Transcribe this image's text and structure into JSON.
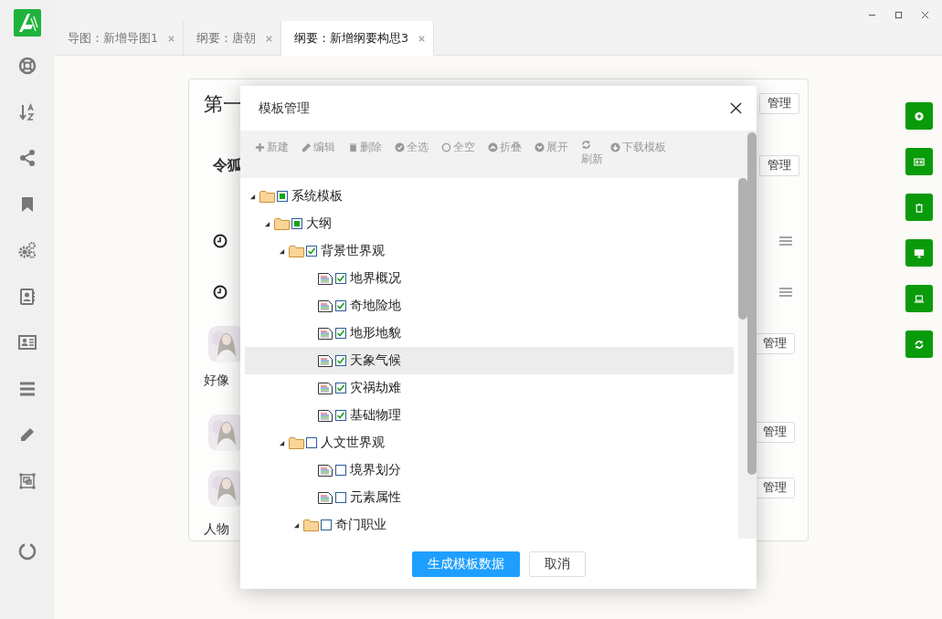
{
  "tabs": [
    {
      "label": "导图：新增导图1",
      "selected": false
    },
    {
      "label": "纲要：唐朝",
      "selected": false
    },
    {
      "label": "纲要：新增纲要构思3",
      "selected": true
    }
  ],
  "card": {
    "title": "第一",
    "subtitle": "令狐",
    "captions": [
      "好像",
      "人物"
    ],
    "manage_buttons": [
      "管理",
      "管理",
      "管理",
      "管理",
      "管理"
    ]
  },
  "dialog": {
    "title": "模板管理",
    "toolbar": [
      "新建",
      "编辑",
      "删除",
      "全选",
      "全空",
      "折叠",
      "展开",
      "刷新",
      "下载模板"
    ],
    "tree": [
      {
        "label": "系统模板",
        "kind": "folder",
        "expanded": true,
        "checked": false,
        "partial": true,
        "selected": false,
        "children": [
          {
            "label": "大纲",
            "kind": "folder",
            "expanded": true,
            "checked": false,
            "partial": true,
            "selected": false,
            "children": [
              {
                "label": "背景世界观",
                "kind": "folder",
                "expanded": true,
                "checked": true,
                "partial": false,
                "selected": false,
                "children": [
                  {
                    "label": "地界概况",
                    "kind": "file",
                    "checked": true,
                    "partial": false,
                    "selected": false
                  },
                  {
                    "label": "奇地险地",
                    "kind": "file",
                    "checked": true,
                    "partial": false,
                    "selected": false
                  },
                  {
                    "label": "地形地貌",
                    "kind": "file",
                    "checked": true,
                    "partial": false,
                    "selected": false
                  },
                  {
                    "label": "天象气候",
                    "kind": "file",
                    "checked": true,
                    "partial": false,
                    "selected": true
                  },
                  {
                    "label": "灾祸劫难",
                    "kind": "file",
                    "checked": true,
                    "partial": false,
                    "selected": false
                  },
                  {
                    "label": "基础物理",
                    "kind": "file",
                    "checked": true,
                    "partial": false,
                    "selected": false
                  }
                ]
              },
              {
                "label": "人文世界观",
                "kind": "folder",
                "expanded": true,
                "checked": false,
                "partial": false,
                "selected": false,
                "children": [
                  {
                    "label": "境界划分",
                    "kind": "file",
                    "checked": false,
                    "partial": false,
                    "selected": false
                  },
                  {
                    "label": "元素属性",
                    "kind": "file",
                    "checked": false,
                    "partial": false,
                    "selected": false
                  },
                  {
                    "label": "奇门职业",
                    "kind": "folder",
                    "expanded": true,
                    "checked": false,
                    "partial": false,
                    "selected": false
                  }
                ]
              }
            ]
          }
        ]
      }
    ],
    "buttons": [
      {
        "label": "生成模板数据",
        "kind": "primary"
      },
      {
        "label": "取消",
        "kind": "default"
      }
    ]
  }
}
